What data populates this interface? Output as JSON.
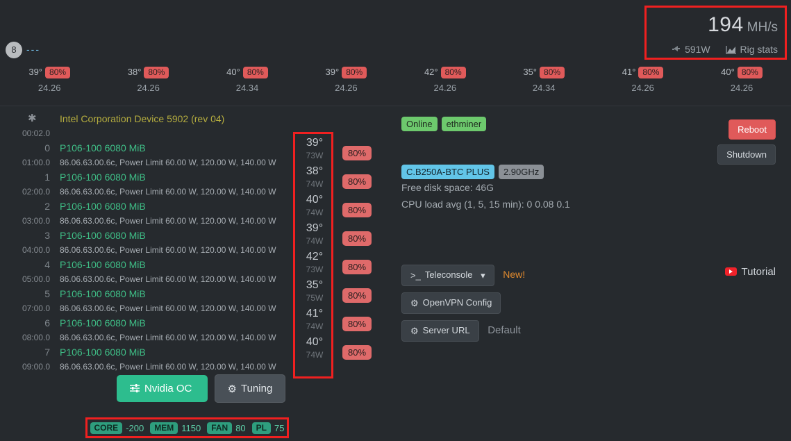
{
  "rig": {
    "hashrate": "194",
    "hashrate_unit": "MH/s",
    "power": "591W",
    "stats_label": "Rig stats",
    "gpu_count": "8",
    "dashes": "---"
  },
  "gpu_summary": [
    {
      "temp": "39°",
      "fan": "80%",
      "hash": "24.26"
    },
    {
      "temp": "38°",
      "fan": "80%",
      "hash": "24.26"
    },
    {
      "temp": "40°",
      "fan": "80%",
      "hash": "24.34"
    },
    {
      "temp": "39°",
      "fan": "80%",
      "hash": "24.26"
    },
    {
      "temp": "42°",
      "fan": "80%",
      "hash": "24.26"
    },
    {
      "temp": "35°",
      "fan": "80%",
      "hash": "24.34"
    },
    {
      "temp": "41°",
      "fan": "80%",
      "hash": "24.26"
    },
    {
      "temp": "40°",
      "fan": "80%",
      "hash": "24.26"
    }
  ],
  "gpu_list": {
    "header": {
      "bus": "00:02.0",
      "name": "Intel Corporation Device 5902 (rev 04)",
      "icon": "asterisk-icon"
    },
    "rows": [
      {
        "idx": "0",
        "bus": "01:00.0",
        "name": "P106-100 6080 MiB",
        "detail": "86.06.63.00.6c, Power Limit 60.00 W, 120.00 W, 140.00 W"
      },
      {
        "idx": "1",
        "bus": "02:00.0",
        "name": "P106-100 6080 MiB",
        "detail": "86.06.63.00.6c, Power Limit 60.00 W, 120.00 W, 140.00 W"
      },
      {
        "idx": "2",
        "bus": "03:00.0",
        "name": "P106-100 6080 MiB",
        "detail": "86.06.63.00.6c, Power Limit 60.00 W, 120.00 W, 140.00 W"
      },
      {
        "idx": "3",
        "bus": "04:00.0",
        "name": "P106-100 6080 MiB",
        "detail": "86.06.63.00.6c, Power Limit 60.00 W, 120.00 W, 140.00 W"
      },
      {
        "idx": "4",
        "bus": "05:00.0",
        "name": "P106-100 6080 MiB",
        "detail": "86.06.63.00.6c, Power Limit 60.00 W, 120.00 W, 140.00 W"
      },
      {
        "idx": "5",
        "bus": "07:00.0",
        "name": "P106-100 6080 MiB",
        "detail": "86.06.63.00.6c, Power Limit 60.00 W, 120.00 W, 140.00 W"
      },
      {
        "idx": "6",
        "bus": "08:00.0",
        "name": "P106-100 6080 MiB",
        "detail": "86.06.63.00.6c, Power Limit 60.00 W, 120.00 W, 140.00 W"
      },
      {
        "idx": "7",
        "bus": "09:00.0",
        "name": "P106-100 6080 MiB",
        "detail": "86.06.63.00.6c, Power Limit 60.00 W, 120.00 W, 140.00 W"
      }
    ]
  },
  "gpu_temps": [
    {
      "temp": "39°",
      "watt": "73W",
      "fan": "80%"
    },
    {
      "temp": "38°",
      "watt": "74W",
      "fan": "80%"
    },
    {
      "temp": "40°",
      "watt": "74W",
      "fan": "80%"
    },
    {
      "temp": "39°",
      "watt": "74W",
      "fan": "80%"
    },
    {
      "temp": "42°",
      "watt": "73W",
      "fan": "80%"
    },
    {
      "temp": "35°",
      "watt": "75W",
      "fan": "80%"
    },
    {
      "temp": "41°",
      "watt": "74W",
      "fan": "80%"
    },
    {
      "temp": "40°",
      "watt": "74W",
      "fan": "80%"
    }
  ],
  "status": {
    "online": "Online",
    "miner": "ethminer",
    "motherboard": "C.B250A-BTC PLUS",
    "cpu_freq": "2.90GHz",
    "disk": "Free disk space: 46G",
    "cpu_load": "CPU load avg (1, 5, 15 min): 0 0.08 0.1"
  },
  "actions": {
    "reboot": "Reboot",
    "shutdown": "Shutdown",
    "teleconsole": "Teleconsole",
    "teleconsole_new": "New!",
    "openvpn": "OpenVPN Config",
    "server_url": "Server URL",
    "server_url_value": "Default",
    "tutorial": "Tutorial"
  },
  "oc": {
    "nvidia_oc": "Nvidia OC",
    "tuning": "Tuning",
    "core_label": "CORE",
    "core_value": "-200",
    "mem_label": "MEM",
    "mem_value": "1150",
    "fan_label": "FAN",
    "fan_value": "80",
    "pl_label": "PL",
    "pl_value": "75"
  },
  "colors": {
    "accent_red": "#f02020",
    "green_badge": "#6dc96d",
    "blue_badge": "#62c5e8",
    "teal": "#2dbd8e",
    "orange": "#e08a2e"
  }
}
